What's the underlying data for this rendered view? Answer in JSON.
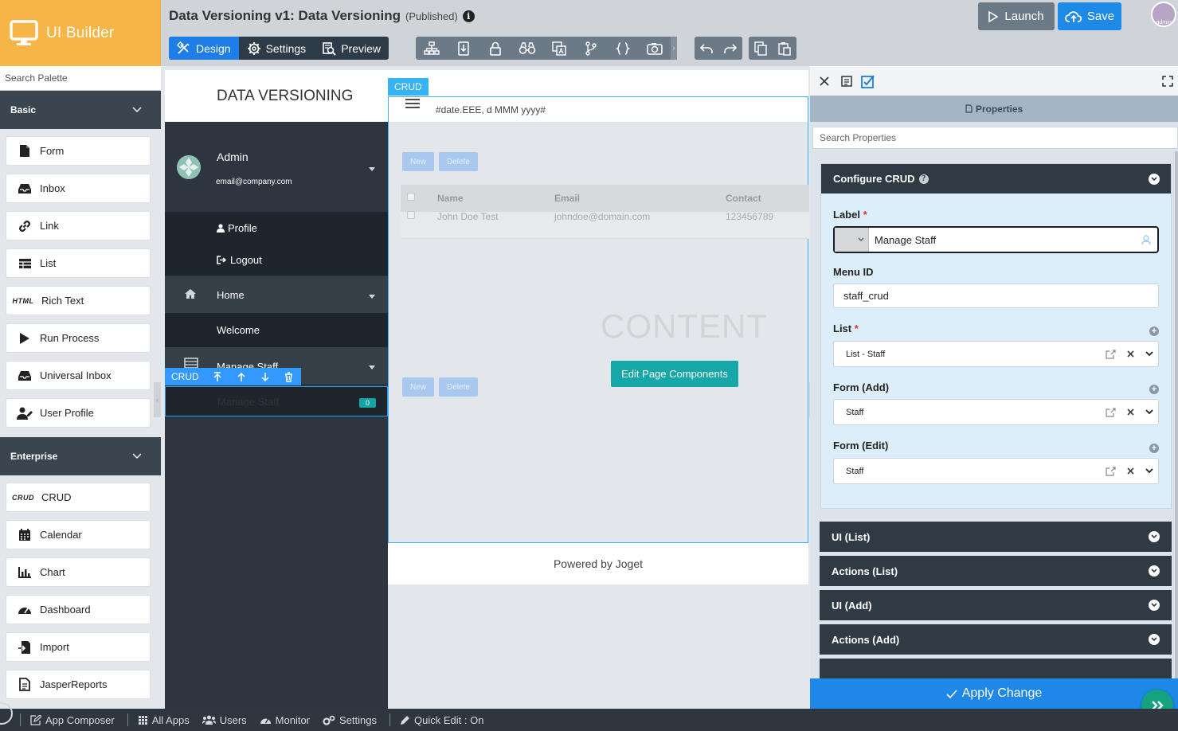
{
  "brand": {
    "label": "UI Builder",
    "icon": "monitor-icon"
  },
  "header": {
    "title": "Data Versioning v1: Data Versioning",
    "status": "(Published)",
    "info_glyph": "i",
    "modes": [
      {
        "label": "Design",
        "icon": "design-icon",
        "active": true
      },
      {
        "label": "Settings",
        "icon": "gear-icon",
        "active": false
      },
      {
        "label": "Preview",
        "icon": "preview-icon",
        "active": false
      }
    ],
    "launch_label": "Launch",
    "save_label": "Save",
    "user_label": "admin",
    "more_glyph": "›"
  },
  "palette": {
    "search_placeholder": "Search Palette",
    "sections": [
      {
        "label": "Basic",
        "items": [
          {
            "label": "Form",
            "icon": "form-icon"
          },
          {
            "label": "Inbox",
            "icon": "inbox-icon"
          },
          {
            "label": "Link",
            "icon": "link-icon"
          },
          {
            "label": "List",
            "icon": "list-icon"
          },
          {
            "label": "Rich Text",
            "icon": "html-icon",
            "tag": "HTML"
          },
          {
            "label": "Run Process",
            "icon": "play-icon"
          },
          {
            "label": "Universal Inbox",
            "icon": "inbox-icon"
          },
          {
            "label": "User Profile",
            "icon": "user-profile-icon"
          }
        ]
      },
      {
        "label": "Enterprise",
        "items": [
          {
            "label": "CRUD",
            "icon": "crud-icon",
            "tag": "CRUD"
          },
          {
            "label": "Calendar",
            "icon": "calendar-icon"
          },
          {
            "label": "Chart",
            "icon": "chart-icon"
          },
          {
            "label": "Dashboard",
            "icon": "dashboard-icon"
          },
          {
            "label": "Import",
            "icon": "import-icon"
          },
          {
            "label": "JasperReports",
            "icon": "report-icon"
          }
        ]
      }
    ],
    "collapse_glyph": "‹"
  },
  "canvas": {
    "app_name": "DATA VERSIONING",
    "user": {
      "name": "Admin",
      "email": "email@company.com"
    },
    "profile_label": "Profile",
    "logout_label": "Logout",
    "home_label": "Home",
    "welcome_label": "Welcome",
    "manage_staff_category": "Manage Staff",
    "manage_staff_item": "Manage Staff",
    "badge_count": "0",
    "crud_tag": "CRUD",
    "crud_toolbar_label": "CRUD",
    "date_format": "#date.EEE, d MMM yyyy#",
    "new_label": "New",
    "delete_label": "Delete",
    "table": {
      "columns": [
        "Name",
        "Email",
        "Contact"
      ],
      "rows": [
        [
          "John Doe Test",
          "johndoe@domain.com",
          "123456789"
        ]
      ]
    },
    "content_watermark": "CONTENT",
    "edit_components_label": "Edit Page Components",
    "footer": "Powered by Joget",
    "split_glyph": "⋮"
  },
  "properties": {
    "title": "Properties",
    "search_placeholder": "Search Properties",
    "section_title": "Configure CRUD",
    "help_glyph": "?",
    "required_mark": "*",
    "add_glyph": "+",
    "fields": {
      "label": {
        "label": "Label",
        "value": "Manage Staff"
      },
      "menu_id": {
        "label": "Menu ID",
        "value": "staff_crud"
      },
      "list": {
        "label": "List",
        "value": "List - Staff"
      },
      "form_add": {
        "label": "Form (Add)",
        "value": "Staff"
      },
      "form_edit": {
        "label": "Form (Edit)",
        "value": "Staff"
      }
    },
    "collapsed_sections": [
      "UI (List)",
      "Actions (List)",
      "UI (Add)",
      "Actions (Add)"
    ],
    "apply_label": "Apply Change"
  },
  "bottombar": {
    "items": [
      {
        "label": "App Composer",
        "icon": "edit-icon"
      },
      {
        "label": "All Apps",
        "icon": "grid-icon"
      },
      {
        "label": "Users",
        "icon": "users-icon"
      },
      {
        "label": "Monitor",
        "icon": "monitor-gauge-icon"
      },
      {
        "label": "Settings",
        "icon": "gears-icon"
      },
      {
        "label": "Quick Edit : On",
        "icon": "pencil-icon"
      }
    ]
  },
  "colors": {
    "brand": "#f8b547",
    "accent": "#1e7de6",
    "teal": "#16a8a8",
    "dark": "#2d3640"
  }
}
